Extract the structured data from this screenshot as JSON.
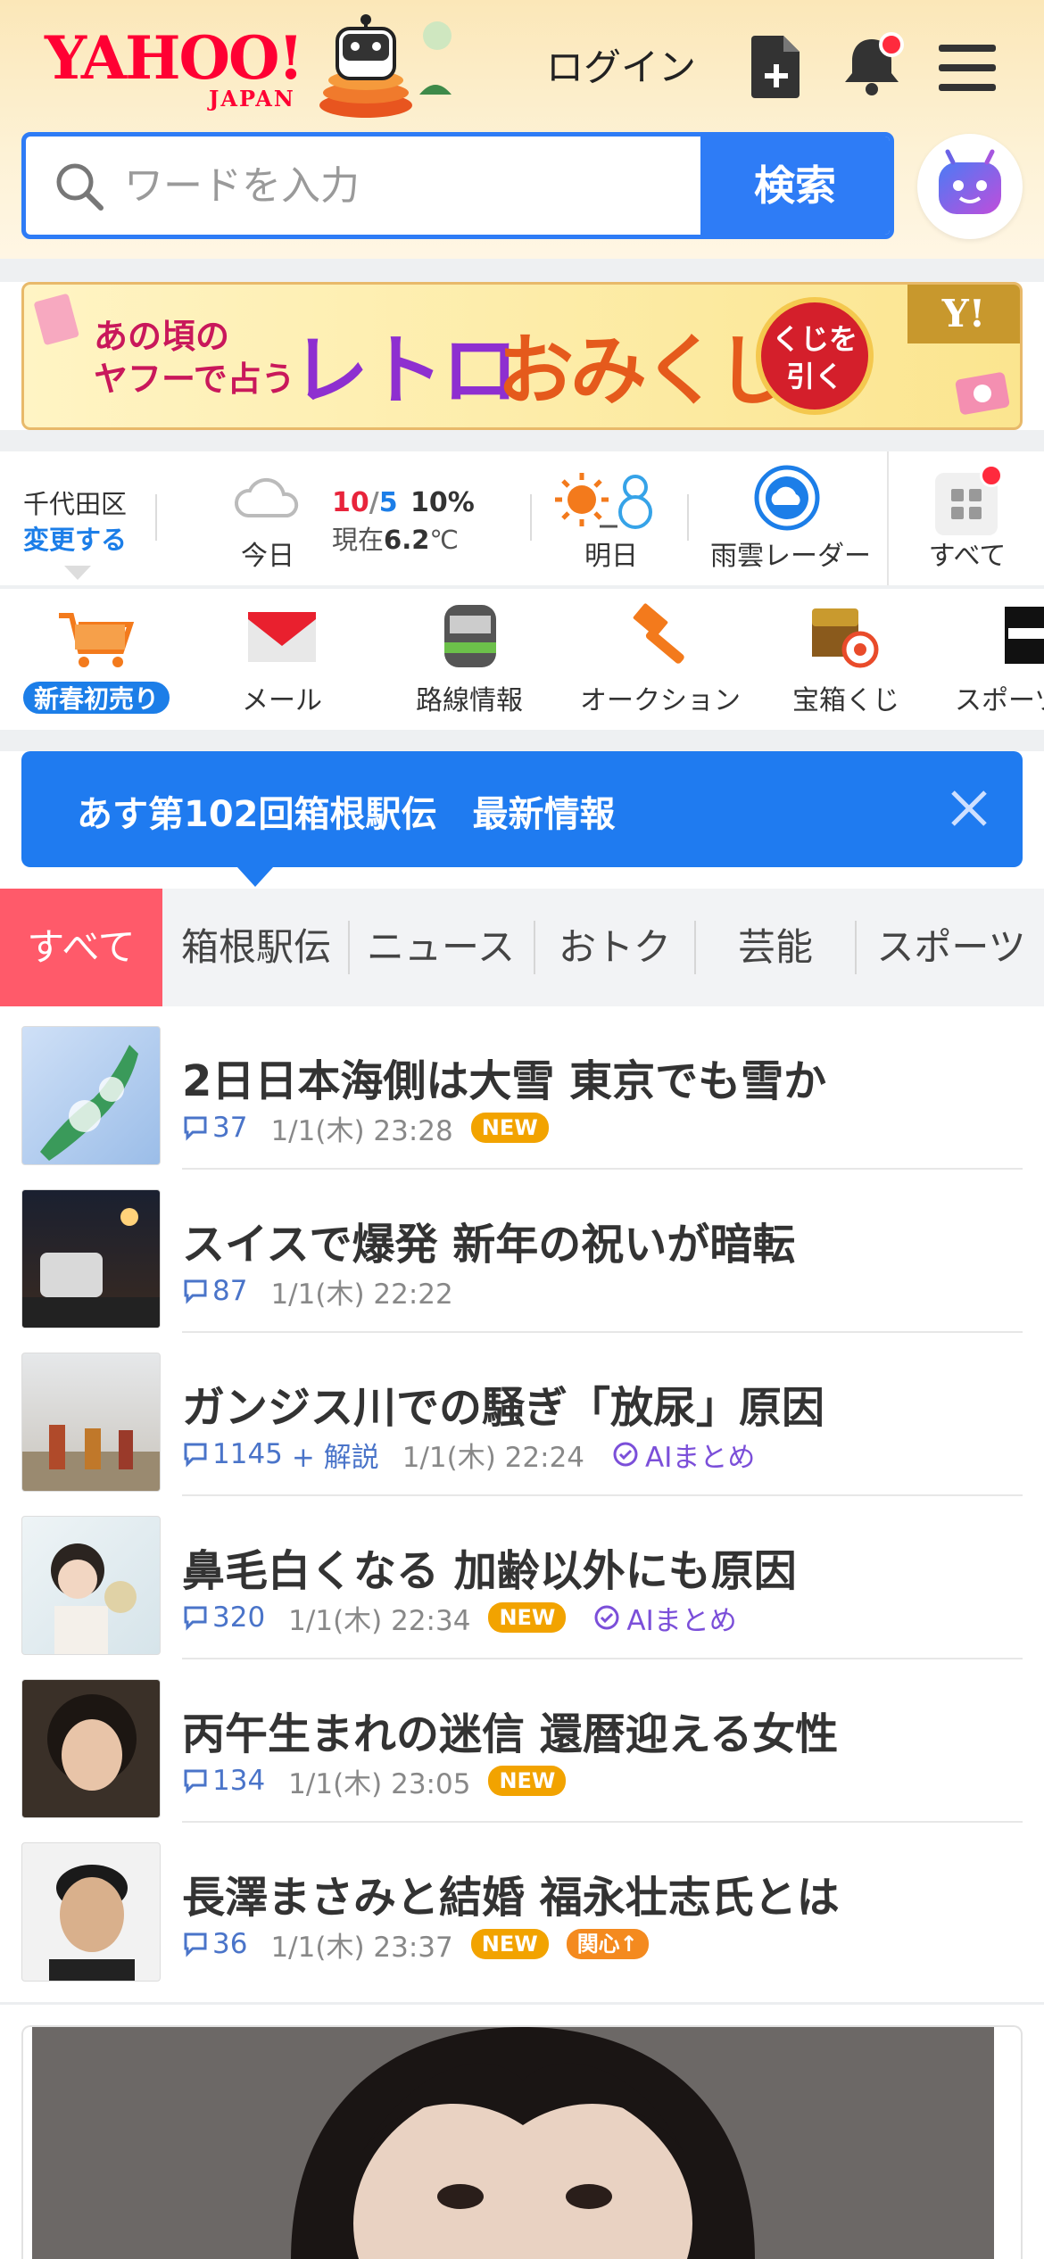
{
  "header": {
    "logo_main": "YAHOO!",
    "logo_sub": "JAPAN",
    "login_label": "ログイン"
  },
  "search": {
    "placeholder": "ワードを入力",
    "button_label": "検索"
  },
  "banner": {
    "left_text_line1": "あの頃の",
    "left_text_line2": "ヤフーで占う",
    "retro": "レトロ",
    "omikuji": "おみくじ",
    "circle_line1": "くじを",
    "circle_line2": "引く",
    "corner": "Y!"
  },
  "weather": {
    "location": "千代田区",
    "change_label": "変更する",
    "today_label": "今日",
    "temp_high": "10",
    "temp_sep": "/",
    "temp_low": "5",
    "precip": "10%",
    "now_prefix": "現在",
    "now_temp": "6.2",
    "now_unit": "℃",
    "tomorrow_label": "明日",
    "radar_label": "雨雲レーダー",
    "all_label": "すべて",
    "colors": {
      "high": "#e8243b",
      "low": "#1c7ee8"
    }
  },
  "services": [
    {
      "label": "新春初売り",
      "icon": "shopping-cart-icon"
    },
    {
      "label": "メール",
      "icon": "mail-icon"
    },
    {
      "label": "路線情報",
      "icon": "train-icon"
    },
    {
      "label": "オークション",
      "icon": "auction-hammer-icon"
    },
    {
      "label": "宝箱くじ",
      "icon": "treasure-box-icon"
    },
    {
      "label": "スポーツ",
      "icon": "sports-icon"
    }
  ],
  "notice": {
    "text": "あす第102回箱根駅伝　最新情報"
  },
  "tabs": [
    {
      "label": "すべて",
      "active": true
    },
    {
      "label": "箱根駅伝"
    },
    {
      "label": "ニュース"
    },
    {
      "label": "おトク"
    },
    {
      "label": "芸能"
    },
    {
      "label": "スポーツ"
    }
  ],
  "news": [
    {
      "title": "2日日本海側は大雪 東京でも雪か",
      "comments": "37",
      "time": "1/1(木) 23:28",
      "new": "NEW"
    },
    {
      "title": "スイスで爆発 新年の祝いが暗転",
      "comments": "87",
      "time": "1/1(木) 22:22"
    },
    {
      "title": "ガンジス川での騒ぎ「放尿」原因",
      "comments": "1145",
      "kaisetsu": "+ 解説",
      "time": "1/1(木) 22:24",
      "ai": "AIまとめ"
    },
    {
      "title": "鼻毛白くなる 加齢以外にも原因",
      "comments": "320",
      "time": "1/1(木) 22:34",
      "new": "NEW",
      "ai": "AIまとめ"
    },
    {
      "title": "丙午生まれの迷信 還暦迎える女性",
      "comments": "134",
      "time": "1/1(木) 23:05",
      "new": "NEW"
    },
    {
      "title": "長澤まさみと結婚 福永壮志氏とは",
      "comments": "36",
      "time": "1/1(木) 23:37",
      "new": "NEW",
      "kanshin": "関心↑"
    }
  ]
}
